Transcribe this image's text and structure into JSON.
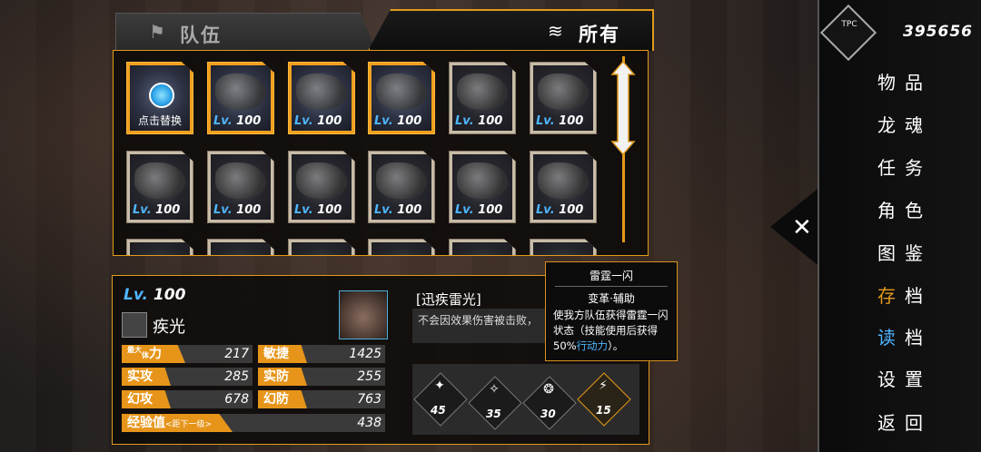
{
  "tabs": {
    "team": "队伍",
    "all": "所有"
  },
  "grid": {
    "row1": [
      {
        "label": "点击替换",
        "selected": true
      },
      {
        "level": "100",
        "selected": true
      },
      {
        "level": "100",
        "selected": true
      },
      {
        "level": "100",
        "selected": true
      },
      {
        "level": "100",
        "selected": false
      },
      {
        "level": "100",
        "selected": false
      }
    ],
    "row2": [
      {
        "level": "100"
      },
      {
        "level": "100"
      },
      {
        "level": "100"
      },
      {
        "level": "100"
      },
      {
        "level": "100"
      },
      {
        "level": "100"
      }
    ],
    "lv_prefix": "Lv."
  },
  "detail": {
    "lv_prefix": "Lv.",
    "level": "100",
    "name": "疾光",
    "stats": [
      {
        "label": "最大体力",
        "label_small": "最大",
        "label_small2": "体",
        "label_big": "力",
        "value": "217"
      },
      {
        "label": "敏捷",
        "value": "1425"
      },
      {
        "label": "实攻",
        "value": "285"
      },
      {
        "label": "实防",
        "value": "255"
      },
      {
        "label": "幻攻",
        "value": "678"
      },
      {
        "label": "幻防",
        "value": "763"
      }
    ],
    "exp": {
      "label": "经验值",
      "sub": "<距下一级>",
      "value": "438"
    },
    "skill_name": "[迅疾雷光]",
    "skill_desc": "不会因效果伤害被击败，",
    "slots": [
      {
        "num": "45"
      },
      {
        "num": "35"
      },
      {
        "num": "30"
      },
      {
        "num": "15"
      }
    ]
  },
  "tooltip": {
    "title": "雷霆一闪",
    "type": "变革·辅助",
    "desc_a": "使我方队伍获得雷霆一闪状态（技能使用后获得50%",
    "desc_hl": "行动力",
    "desc_b": "）。"
  },
  "currency": {
    "icon_text": "TPC",
    "value": "395656"
  },
  "menu": [
    "物品",
    "龙魂",
    "任务",
    "角色",
    "图鉴",
    "存档",
    "读档",
    "设置",
    "返回"
  ],
  "colors": {
    "accent": "#e19a1b",
    "blue": "#4fb6ff"
  }
}
